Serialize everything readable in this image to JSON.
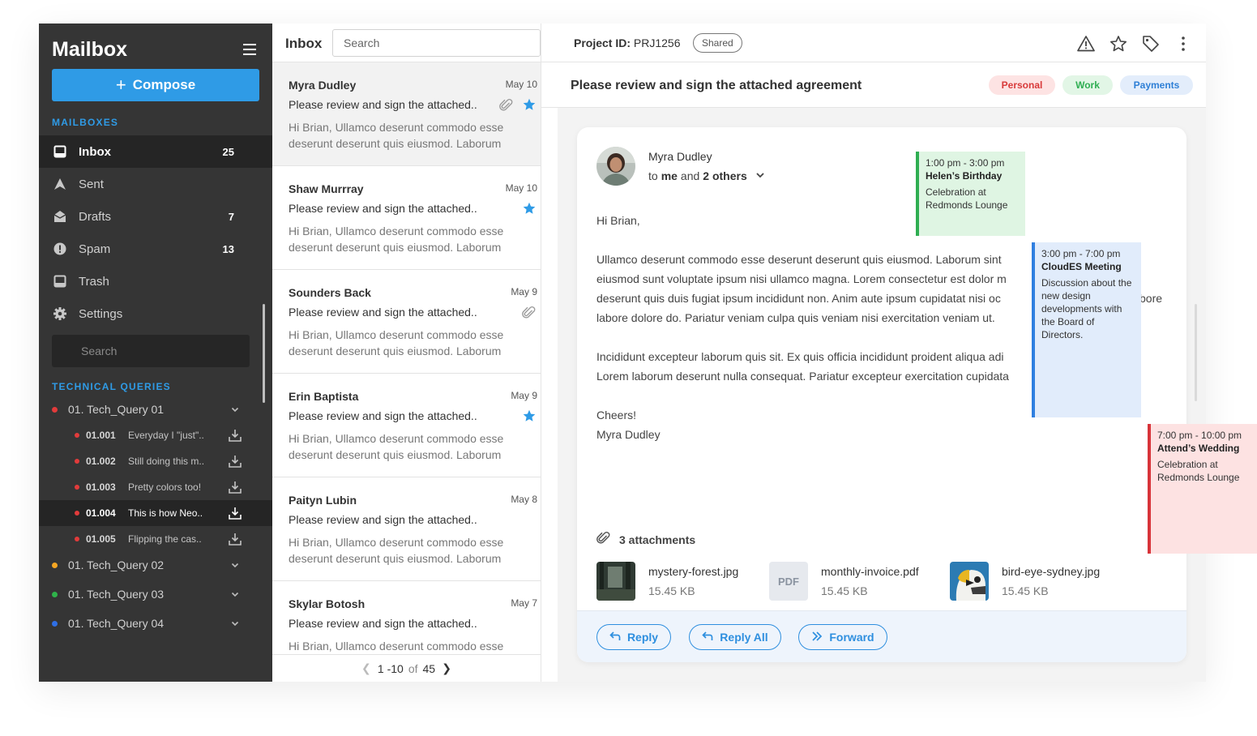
{
  "sidebar": {
    "brand": "Mailbox",
    "compose_label": "Compose",
    "mailboxes_label": "MAILBOXES",
    "items": [
      {
        "label": "Inbox",
        "count": "25"
      },
      {
        "label": "Sent",
        "count": ""
      },
      {
        "label": "Drafts",
        "count": "7"
      },
      {
        "label": "Spam",
        "count": "13"
      },
      {
        "label": "Trash",
        "count": ""
      },
      {
        "label": "Settings",
        "count": ""
      }
    ],
    "search_placeholder": "Search",
    "technical_label": "TECHNICAL QUERIES",
    "queries": [
      {
        "label": "01.  Tech_Query 01",
        "color": "#e23b3b"
      },
      {
        "label": "01.  Tech_Query 02",
        "color": "#f5a623"
      },
      {
        "label": "01.  Tech_Query 03",
        "color": "#2fb34a"
      },
      {
        "label": "01.  Tech_Query 04",
        "color": "#2f6fe6"
      }
    ],
    "subqueries": [
      {
        "code": "01.001",
        "text": "Everyday I \"just\".."
      },
      {
        "code": "01.002",
        "text": "Still doing this m.."
      },
      {
        "code": "01.003",
        "text": "Pretty colors too!"
      },
      {
        "code": "01.004",
        "text": "This is how Neo.."
      },
      {
        "code": "01.005",
        "text": "Flipping the cas.."
      }
    ]
  },
  "list": {
    "title": "Inbox",
    "search_placeholder": "Search",
    "mails": [
      {
        "sender": "Myra Dudley",
        "date": "May 10",
        "subject": "Please review and sign the attached..",
        "preview": "Hi Brian, Ullamco deserunt commodo esse deserunt deserunt quis eiusmod. Laborum",
        "attachment": true,
        "starred": true
      },
      {
        "sender": "Shaw Murrray",
        "date": "May 10",
        "subject": "Please review and sign the attached..",
        "preview": "Hi Brian, Ullamco deserunt commodo esse deserunt deserunt quis eiusmod. Laborum",
        "attachment": false,
        "starred": true
      },
      {
        "sender": "Sounders Back",
        "date": "May 9",
        "subject": "Please review and sign the attached..",
        "preview": "Hi Brian, Ullamco deserunt commodo esse deserunt deserunt quis eiusmod. Laborum",
        "attachment": true,
        "starred": false
      },
      {
        "sender": "Erin Baptista",
        "date": "May 9",
        "subject": "Please review and sign the attached..",
        "preview": "Hi Brian, Ullamco deserunt commodo esse deserunt deserunt quis eiusmod. Laborum",
        "attachment": false,
        "starred": true
      },
      {
        "sender": "Paityn Lubin",
        "date": "May 8",
        "subject": "Please review and sign the attached..",
        "preview": "Hi Brian, Ullamco deserunt commodo esse deserunt deserunt quis eiusmod. Laborum",
        "attachment": false,
        "starred": false
      },
      {
        "sender": "Skylar Botosh",
        "date": "May 7",
        "subject": "Please review and sign the attached..",
        "preview": "Hi Brian, Ullamco deserunt commodo esse",
        "attachment": false,
        "starred": false
      }
    ],
    "pager": {
      "range": "1 -10",
      "of": "of",
      "total": "45"
    }
  },
  "reader": {
    "project_label": "Project ID:",
    "project_id": "PRJ1256",
    "shared": "Shared",
    "subject": "Please review and sign the attached agreement",
    "tags": [
      {
        "label": "Personal",
        "bg": "#fde3e3",
        "fg": "#d83a3a"
      },
      {
        "label": "Work",
        "bg": "#e2f6e6",
        "fg": "#2fae52"
      },
      {
        "label": "Payments",
        "bg": "#e3edfb",
        "fg": "#2e7fd6"
      }
    ],
    "from_name": "Myra Dudley",
    "to_prefix": "to",
    "to_me": "me",
    "to_and": "and",
    "to_others": "2 others",
    "greeting": "Hi Brian,",
    "para1_lines": [
      "Ullamco deserunt commodo esse deserunt deserunt quis eiusmod. Laborum sint",
      "eiusmod sunt voluptate ipsum nisi ullamco magna. Lorem consectetur est dolor m",
      "deserunt quis duis fugiat ipsum incididunt non. Anim aute ipsum cupidatat nisi oc",
      "labore dolore do. Pariatur veniam culpa quis veniam nisi exercitation veniam ut."
    ],
    "para1_tail": "bore",
    "para2_lines": [
      "Incididunt excepteur laborum quis sit. Ex quis officia incididunt proident aliqua adi",
      "Lorem laborum deserunt nulla consequat. Pariatur excepteur exercitation cupidata"
    ],
    "closing": "Cheers!",
    "signature": "Myra Dudley",
    "attachments_label": "3 attachments",
    "attachments": [
      {
        "name": "mystery-forest.jpg",
        "size": "15.45 KB"
      },
      {
        "name": "monthly-invoice.pdf",
        "size": "15.45 KB",
        "thumb_label": "PDF"
      },
      {
        "name": "bird-eye-sydney.jpg",
        "size": "15.45 KB"
      }
    ],
    "actions": {
      "reply": "Reply",
      "reply_all": "Reply All",
      "forward": "Forward"
    }
  },
  "events": [
    {
      "time": "1:00 pm - 3:00 pm",
      "title": "Helen’s Birthday",
      "desc": "Celebration at Redmonds Lounge",
      "bg": "#dff5e3",
      "border": "#2fae52"
    },
    {
      "time": "3:00 pm - 7:00 pm",
      "title": "CloudES Meeting",
      "desc": "Discussion about the new design developments with the Board of Directors.",
      "bg": "#e1ecfb",
      "border": "#2f7fe0"
    },
    {
      "time": "7:00 pm - 10:00 pm",
      "title": "Attend’s Wedding",
      "desc": "Celebration at Redmonds Lounge",
      "bg": "#fde2e2",
      "border": "#d8343a"
    }
  ]
}
